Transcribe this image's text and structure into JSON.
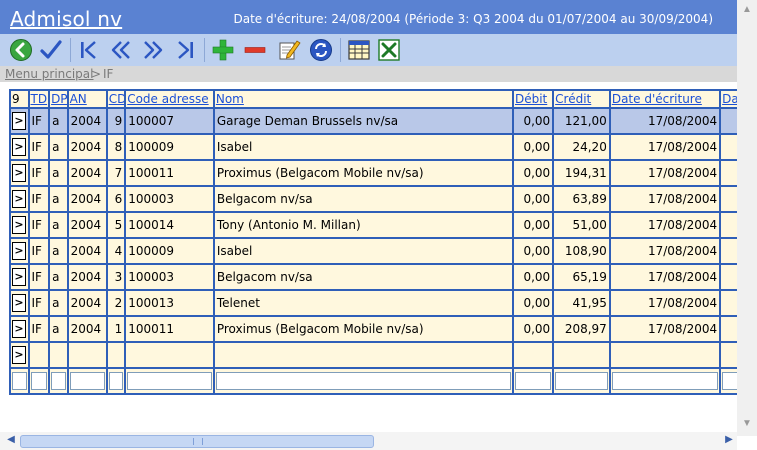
{
  "app": {
    "title": "Admisol nv",
    "period_info": "Date d'écriture: 24/08/2004 (Période 3: Q3 2004 du 01/07/2004 au 30/09/2004)"
  },
  "toolbar": {
    "icons": [
      "back-icon",
      "check-icon",
      "first-record-icon",
      "previous-record-icon",
      "next-record-icon",
      "last-record-icon",
      "add-icon",
      "delete-icon",
      "edit-icon",
      "refresh-icon",
      "table-view-icon",
      "excel-export-icon"
    ]
  },
  "breadcrumb": {
    "root": "Menu principal",
    "separator": ">",
    "current": "IF"
  },
  "grid": {
    "row_button": ">",
    "columns": [
      "9",
      "TD",
      "DP",
      "AN",
      "CD",
      "Code adresse",
      "Nom",
      "Débit",
      "Crédit",
      "Date d'écriture",
      "Da"
    ],
    "rows": [
      [
        "IF",
        "a",
        "2004",
        "9",
        "100007",
        "Garage Deman Brussels nv/sa",
        "0,00",
        "121,00",
        "17/08/2004"
      ],
      [
        "IF",
        "a",
        "2004",
        "8",
        "100009",
        "Isabel",
        "0,00",
        "24,20",
        "17/08/2004"
      ],
      [
        "IF",
        "a",
        "2004",
        "7",
        "100011",
        "Proximus (Belgacom Mobile nv/sa)",
        "0,00",
        "194,31",
        "17/08/2004"
      ],
      [
        "IF",
        "a",
        "2004",
        "6",
        "100003",
        "Belgacom nv/sa",
        "0,00",
        "63,89",
        "17/08/2004"
      ],
      [
        "IF",
        "a",
        "2004",
        "5",
        "100014",
        "Tony (Antonio M. Millan)",
        "0,00",
        "51,00",
        "17/08/2004"
      ],
      [
        "IF",
        "a",
        "2004",
        "4",
        "100009",
        "Isabel",
        "0,00",
        "108,90",
        "17/08/2004"
      ],
      [
        "IF",
        "a",
        "2004",
        "3",
        "100003",
        "Belgacom nv/sa",
        "0,00",
        "65,19",
        "17/08/2004"
      ],
      [
        "IF",
        "a",
        "2004",
        "2",
        "100013",
        "Telenet",
        "0,00",
        "41,95",
        "17/08/2004"
      ],
      [
        "IF",
        "a",
        "2004",
        "1",
        "100011",
        "Proximus (Belgacom Mobile nv/sa)",
        "0,00",
        "208,97",
        "17/08/2004"
      ]
    ],
    "selected_row": 0
  },
  "colors": {
    "title_bar": "#5a82d2",
    "toolbar": "#bcd0ef",
    "grid_border": "#2f5fb8",
    "row_bg": "#fff8de",
    "selected_row_bg": "#b9c8e8",
    "header_link": "#1a4fd6"
  }
}
